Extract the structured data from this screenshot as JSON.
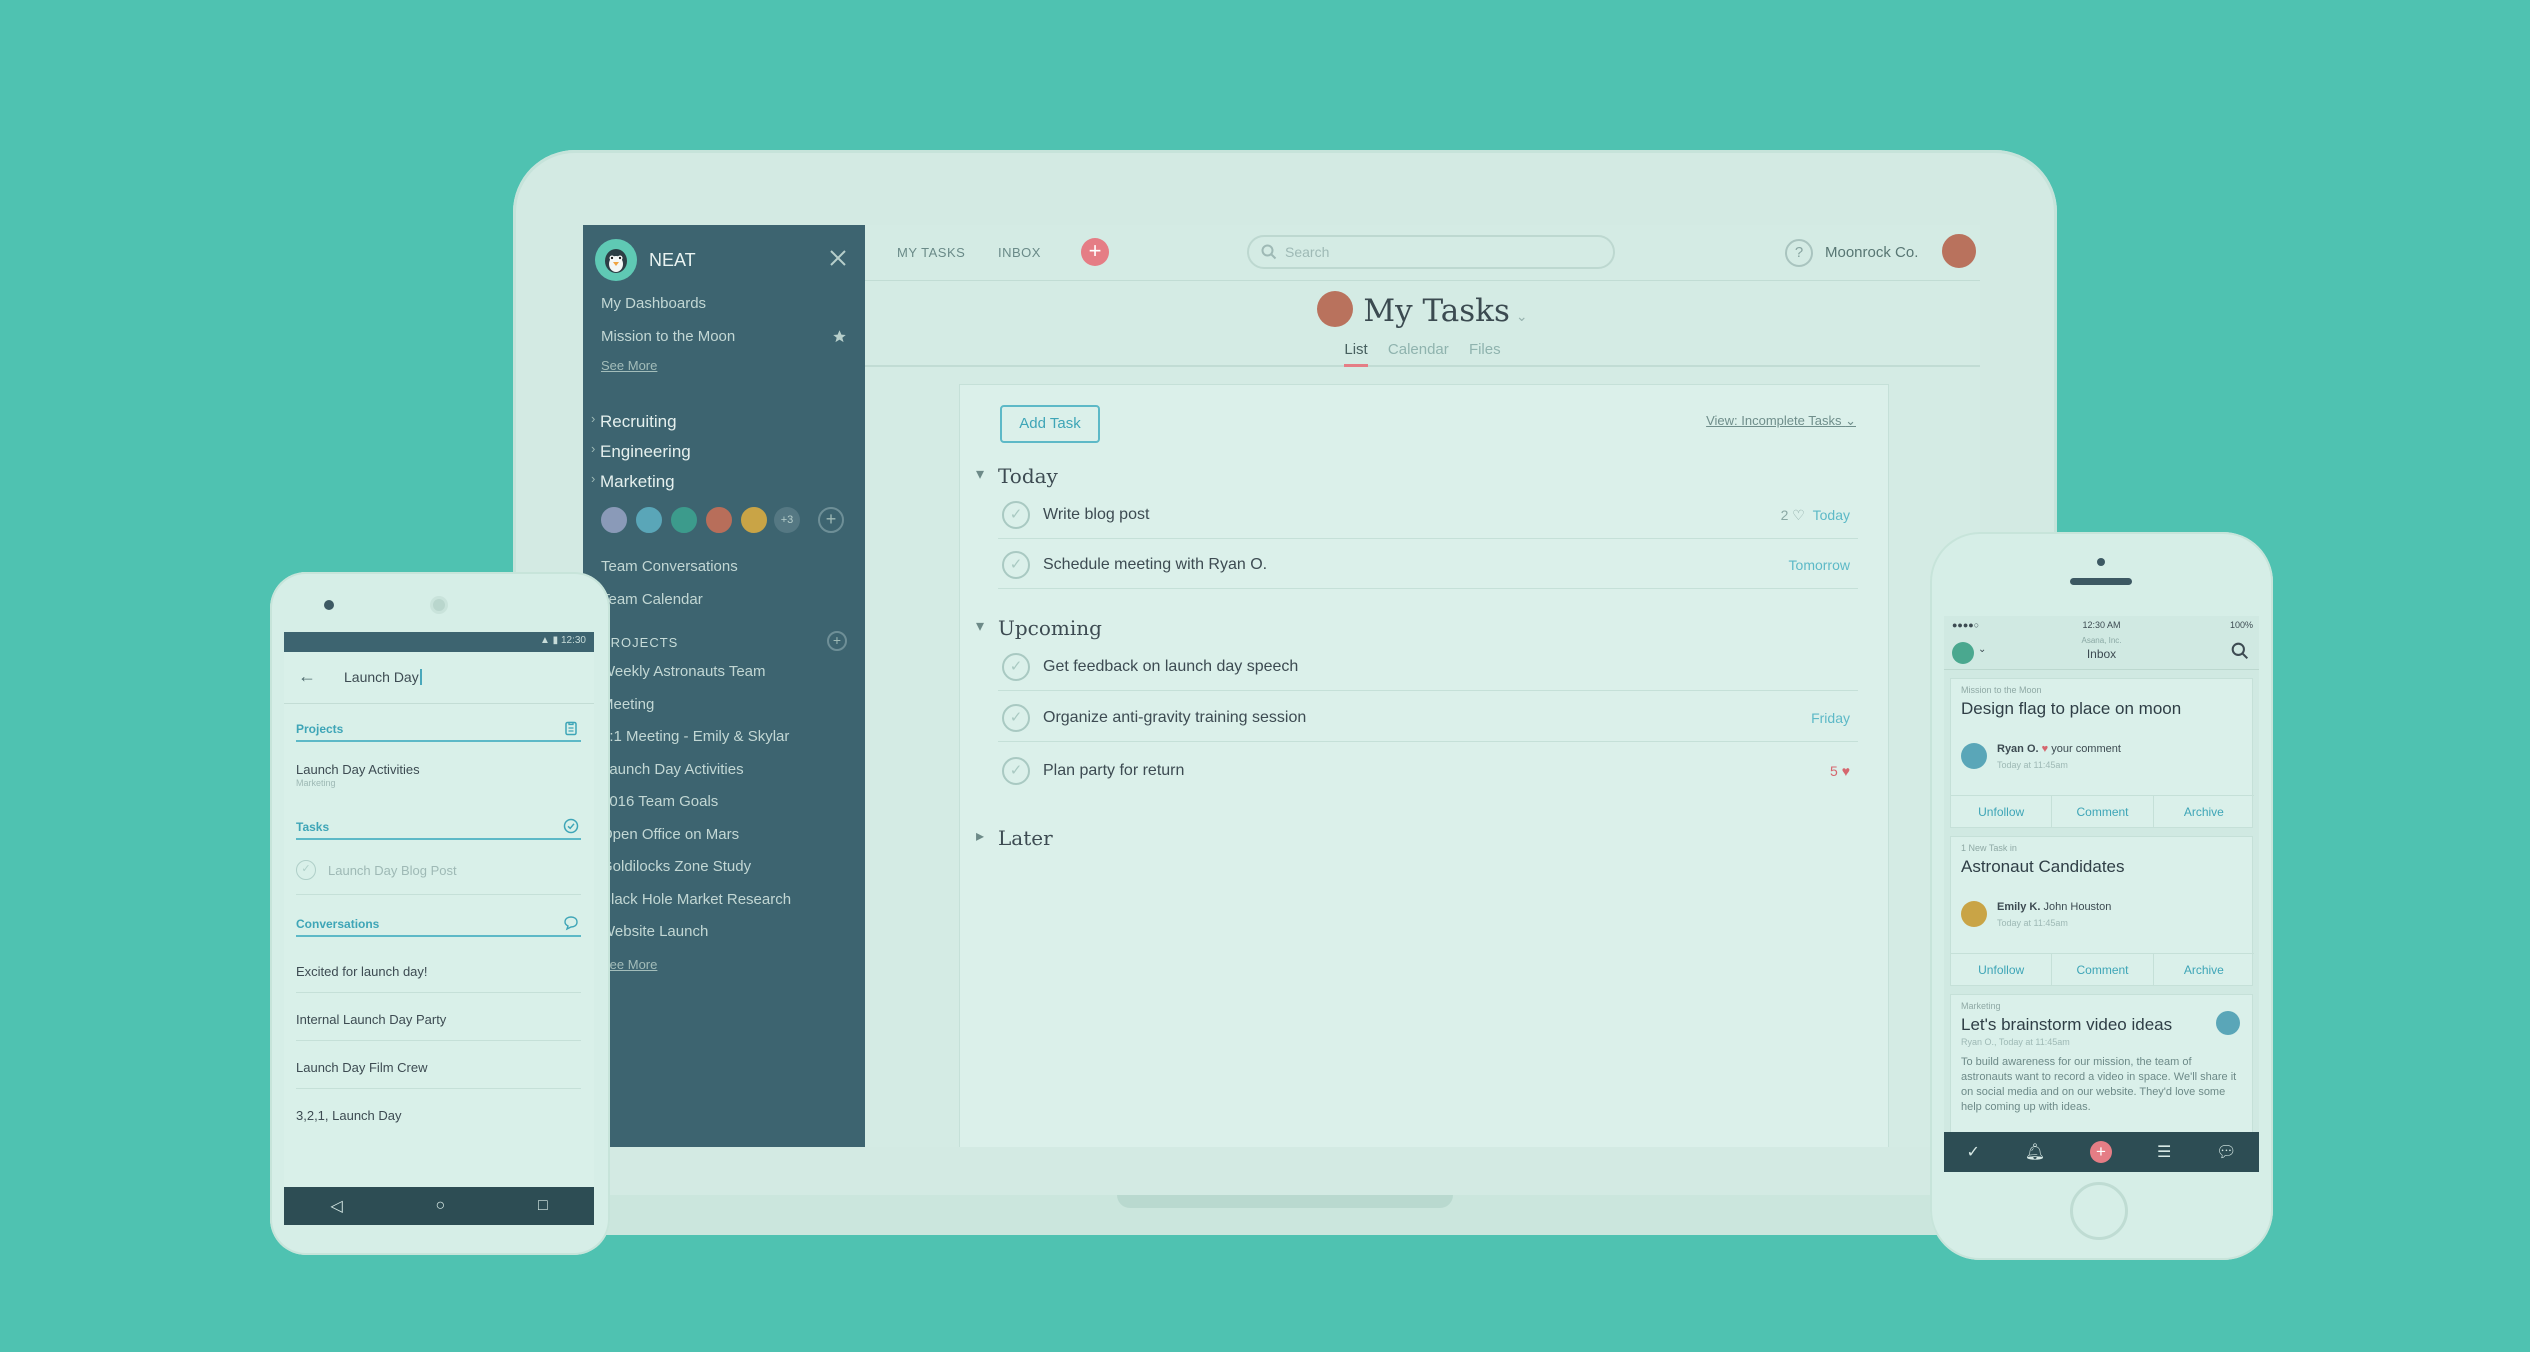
{
  "laptop": {
    "sidebar": {
      "brand": "NEAT",
      "links_top": [
        "My Dashboards",
        "Mission to the Moon"
      ],
      "see_more_1": "See More",
      "teams": [
        "Recruiting",
        "Engineering",
        "Marketing"
      ],
      "members_more": "+3",
      "team_links": [
        "Team Conversations",
        "Team Calendar"
      ],
      "projects_title": "PROJECTS",
      "projects": [
        "Weekly Astronauts Team",
        "Meeting",
        "1:1 Meeting - Emily & Skylar",
        "Launch Day Activities",
        "2016 Team Goals",
        "Open Office on Mars",
        "Goldilocks Zone Study",
        "Black Hole Market Research",
        "Website Launch"
      ],
      "see_more_2": "See More"
    },
    "topbar": {
      "nav_tasks": "MY TASKS",
      "nav_inbox": "INBOX",
      "search_placeholder": "Search",
      "org": "Moonrock Co."
    },
    "page": {
      "title": "My Tasks",
      "tabs": [
        "List",
        "Calendar",
        "Files"
      ]
    },
    "content": {
      "add_task": "Add Task",
      "view_filter": "View: Incomplete Tasks",
      "sections": [
        "Today",
        "Upcoming",
        "Later"
      ],
      "tasks": [
        {
          "name": "Write blog post",
          "count": "2",
          "due": "Today"
        },
        {
          "name": "Schedule meeting with Ryan O.",
          "due": "Tomorrow"
        },
        {
          "name": "Get feedback on launch day speech",
          "due": ""
        },
        {
          "name": "Organize anti-gravity training session",
          "due": "Friday"
        },
        {
          "name": "Plan party for return",
          "count": "5",
          "due": ""
        }
      ]
    }
  },
  "android": {
    "status_time": "12:30",
    "query": "Launch Day",
    "sections": {
      "projects": "Projects",
      "tasks": "Tasks",
      "conversations": "Conversations"
    },
    "project_item": "Launch Day Activities",
    "project_sub": "Marketing",
    "task_item": "Launch Day Blog Post",
    "conversations": [
      "Excited for launch day!",
      "Internal Launch Day Party",
      "Launch Day Film Crew",
      "3,2,1, Launch Day"
    ]
  },
  "iphone": {
    "status_time": "12:30 AM",
    "status_battery": "100%",
    "header_small": "Asana, Inc.",
    "header_title": "Inbox",
    "cards": [
      {
        "eyebrow": "Mission to the Moon",
        "title": "Design flag to place on moon",
        "person": "Ryan O.",
        "action": "your comment",
        "time": "Today at 11:45am"
      },
      {
        "eyebrow": "1 New Task in",
        "title": "Astronaut Candidates",
        "person": "Emily K.",
        "action": "John Houston",
        "time": "Today at 11:45am"
      },
      {
        "eyebrow": "Marketing",
        "title": "Let's brainstorm video ideas",
        "byline": "Ryan O., Today at 11:45am",
        "body": "To build awareness for our mission, the team of astronauts want to record a video in space. We'll share it on social media and on our website. They'd love some help coming up with ideas."
      }
    ],
    "actions": [
      "Unfollow",
      "Comment",
      "Archive"
    ]
  },
  "colors": {
    "background": "#4fc2b1",
    "sidebar": "#3d6470",
    "accent": "#5db9c7",
    "brand_red": "#e57d85"
  }
}
